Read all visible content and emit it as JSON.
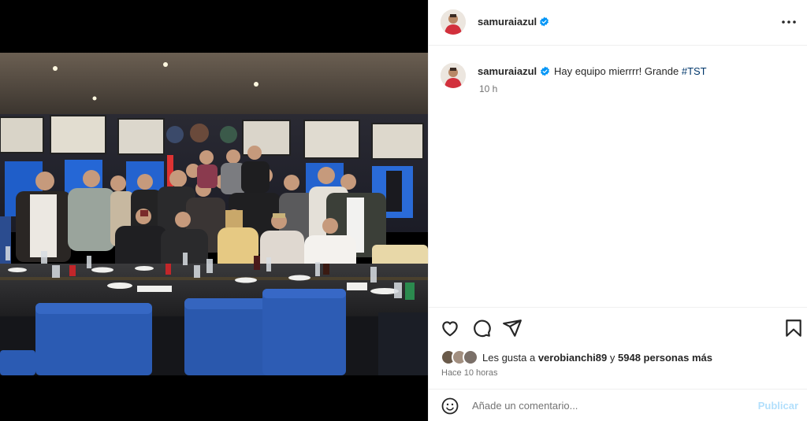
{
  "post": {
    "username": "samuraiazul",
    "verified": true,
    "more_icon": "more-options-icon"
  },
  "caption": {
    "username": "samuraiazul",
    "text": "Hay equipo mierrrr! Grande ",
    "hashtag": "#TST",
    "time": "10 h"
  },
  "actions": {
    "icons": [
      "heart-icon",
      "comment-icon",
      "share-icon",
      "bookmark-icon"
    ]
  },
  "likes": {
    "prefix": "Les gusta a ",
    "user": "verobianchi89",
    "middle": " y ",
    "others": "5948 personas más"
  },
  "posted_ago": "Hace 10 horas",
  "comment": {
    "placeholder": "Añade un comentario...",
    "publish_label": "Publicar"
  },
  "colors": {
    "verified_blue": "#0095f6",
    "hashtag": "#00376b",
    "publish_disabled": "#b2dffc",
    "muted": "#737373"
  }
}
